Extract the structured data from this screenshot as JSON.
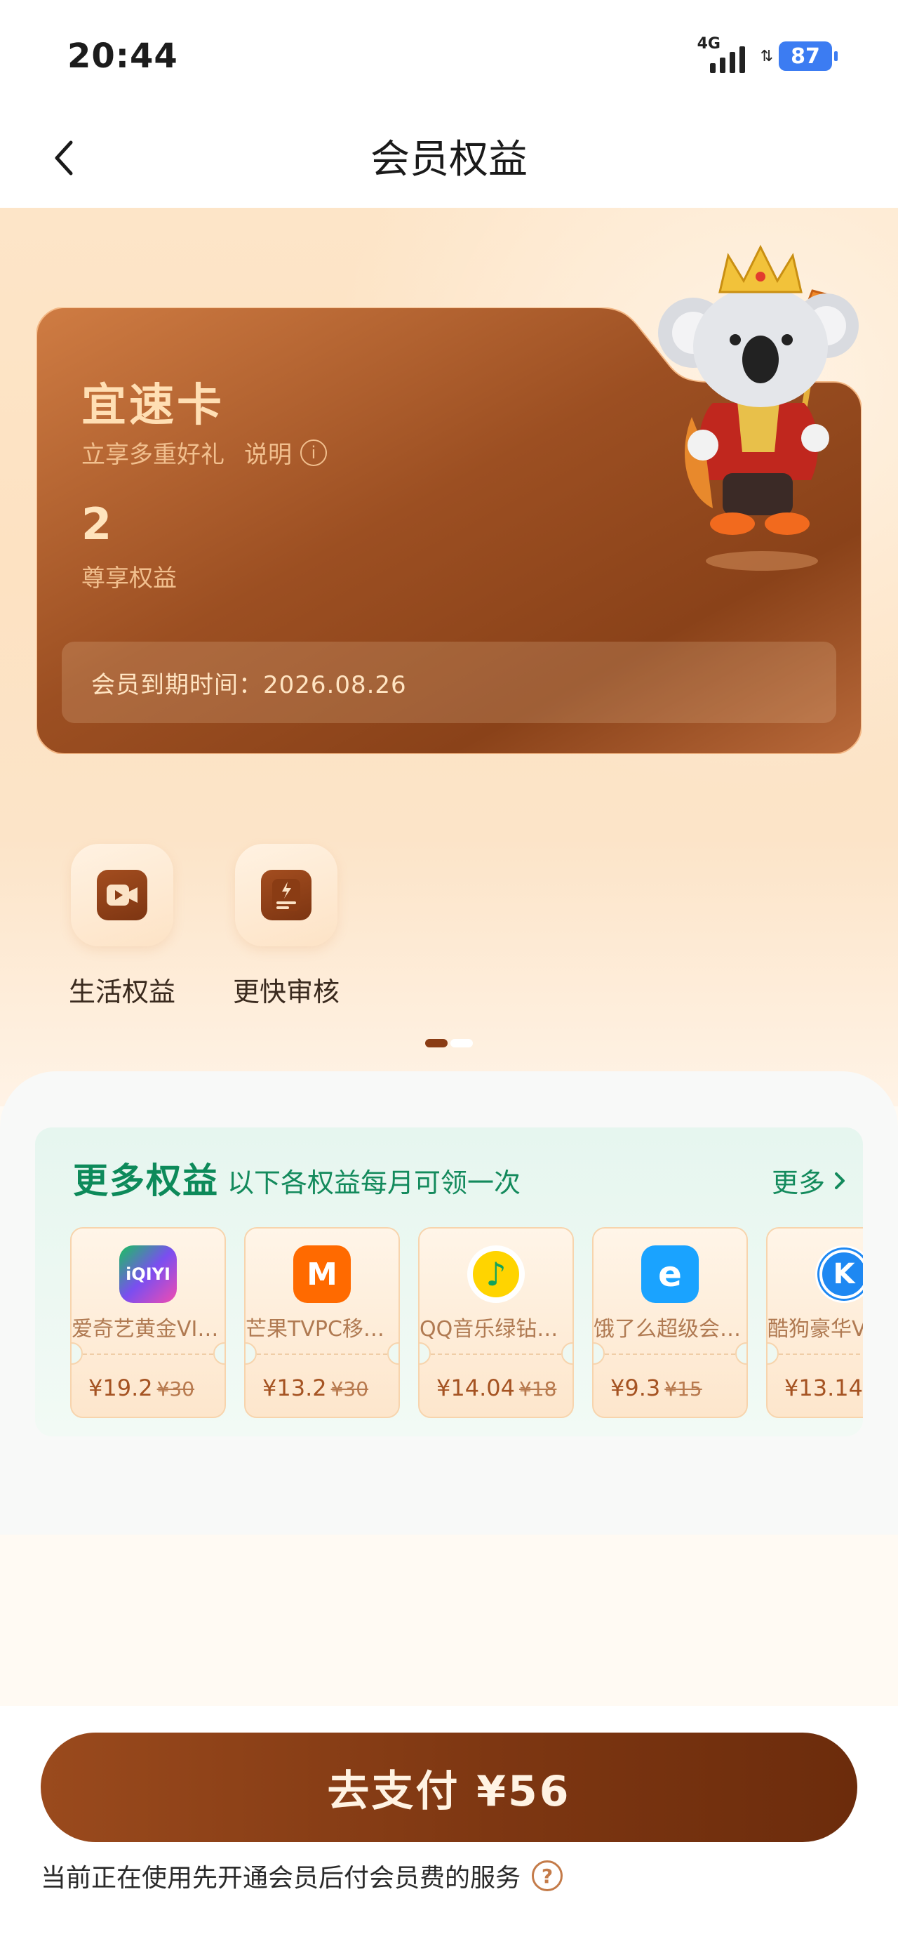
{
  "status": {
    "time": "20:44",
    "network": "4G",
    "battery": "87"
  },
  "nav": {
    "title": "会员权益"
  },
  "card": {
    "title": "宜速卡",
    "subtitle": "立享多重好礼",
    "explain": "说明",
    "benefit_count": "2",
    "benefit_label": "尊享权益",
    "expire_text": "会员到期时间：2026.08.26"
  },
  "perks": [
    {
      "label": "生活权益",
      "icon": "video-play-icon"
    },
    {
      "label": "更快审核",
      "icon": "fast-review-icon"
    }
  ],
  "more": {
    "title": "更多权益",
    "subtitle": "以下各权益每月可领一次",
    "link": "更多"
  },
  "coupons": [
    {
      "name": "爱奇艺黄金VIP…",
      "price": "¥19.2",
      "original": "¥30",
      "logo_text": "iQIYI",
      "color": "#18b35a"
    },
    {
      "name": "芒果TVPC移…",
      "price": "¥13.2",
      "original": "¥30",
      "logo_text": "M",
      "color": "#ff6a00"
    },
    {
      "name": "QQ音乐绿钻…",
      "price": "¥14.04",
      "original": "¥18",
      "logo_text": "♪",
      "color": "#ffd400"
    },
    {
      "name": "饿了么超级会…",
      "price": "¥9.3",
      "original": "¥15",
      "logo_text": "e",
      "color": "#1aa3ff"
    },
    {
      "name": "酷狗豪华VI",
      "price": "¥13.14",
      "original": "¥",
      "logo_text": "K",
      "color": "#1e88f2"
    }
  ],
  "pay": {
    "label": "去支付 ¥56"
  },
  "note": {
    "text": "当前正在使用先开通会员后付会员费的服务",
    "help": "?"
  },
  "colors": {
    "brand_brown": "#7e3712",
    "accent_green": "#0d8a5a",
    "battery_blue": "#3c7cf2"
  }
}
